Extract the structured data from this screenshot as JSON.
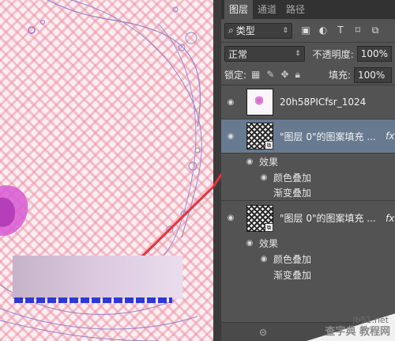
{
  "panel": {
    "tabs": [
      {
        "label": "图层",
        "active": true
      },
      {
        "label": "通道",
        "active": false
      },
      {
        "label": "路径",
        "active": false
      }
    ],
    "filter": {
      "kind_label": "类型",
      "search_icon": "search-icon"
    },
    "filter_icons": [
      "image-filter-icon",
      "adjustment-filter-icon",
      "type-filter-icon",
      "shape-filter-icon",
      "smart-object-filter-icon"
    ],
    "blend_mode": "正常",
    "opacity_label": "不透明度:",
    "opacity_value": "100%",
    "lock_label": "锁定:",
    "fill_label": "填充:",
    "fill_value": "100%",
    "layers": [
      {
        "name": "20h58PICfsr_1024",
        "thumb": "white",
        "fx": false,
        "selected": false
      },
      {
        "name": "\"图层 0\"的图案填充 ...",
        "thumb": "pattern",
        "fx": true,
        "selected": true,
        "effects_label": "效果",
        "effects": [
          "颜色叠加",
          "渐变叠加"
        ]
      },
      {
        "name": "\"图层 0\"的图案填充 ...",
        "thumb": "pattern",
        "fx": true,
        "selected": false,
        "effects_label": "效果",
        "effects": [
          "颜色叠加",
          "渐变叠加"
        ]
      }
    ],
    "fx_label": "fx"
  },
  "watermark": {
    "line1": "jb51.net",
    "line2": "查字典 教程网"
  },
  "colors": {
    "selected_row": "#677a90",
    "arrow": "#e8323a",
    "panel_bg": "#535353"
  }
}
